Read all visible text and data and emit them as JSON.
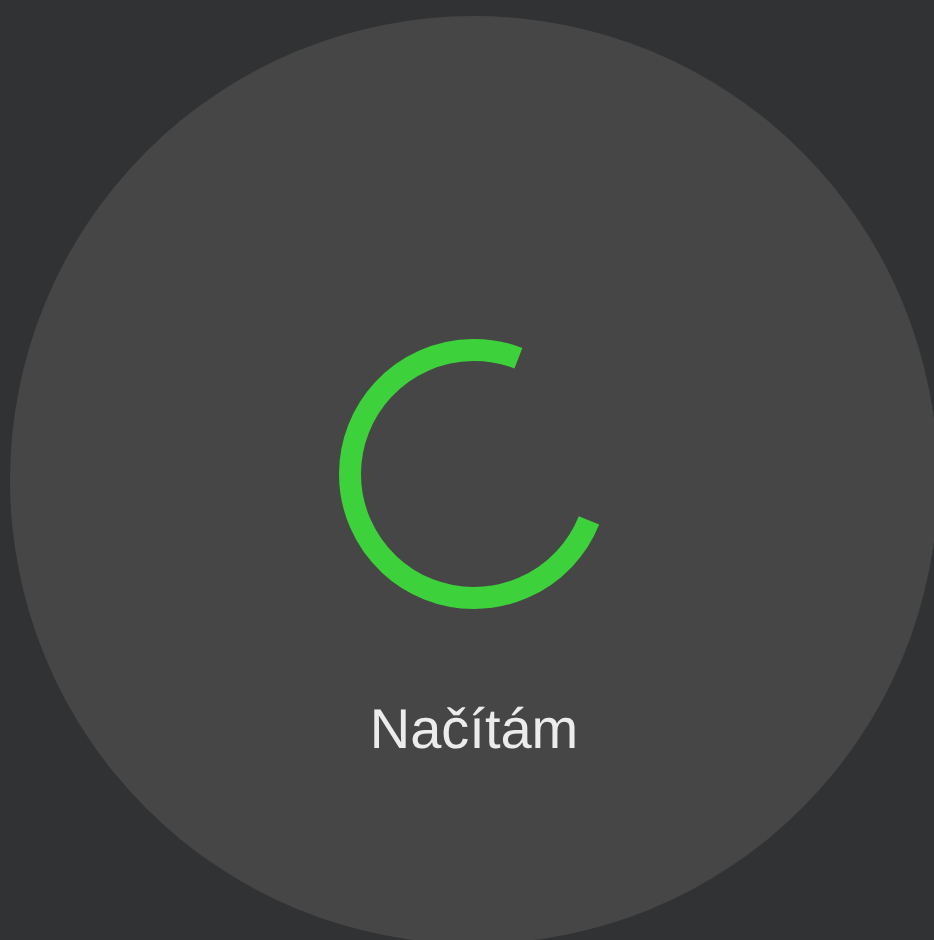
{
  "screen": {
    "loading_text": "Načítám"
  }
}
